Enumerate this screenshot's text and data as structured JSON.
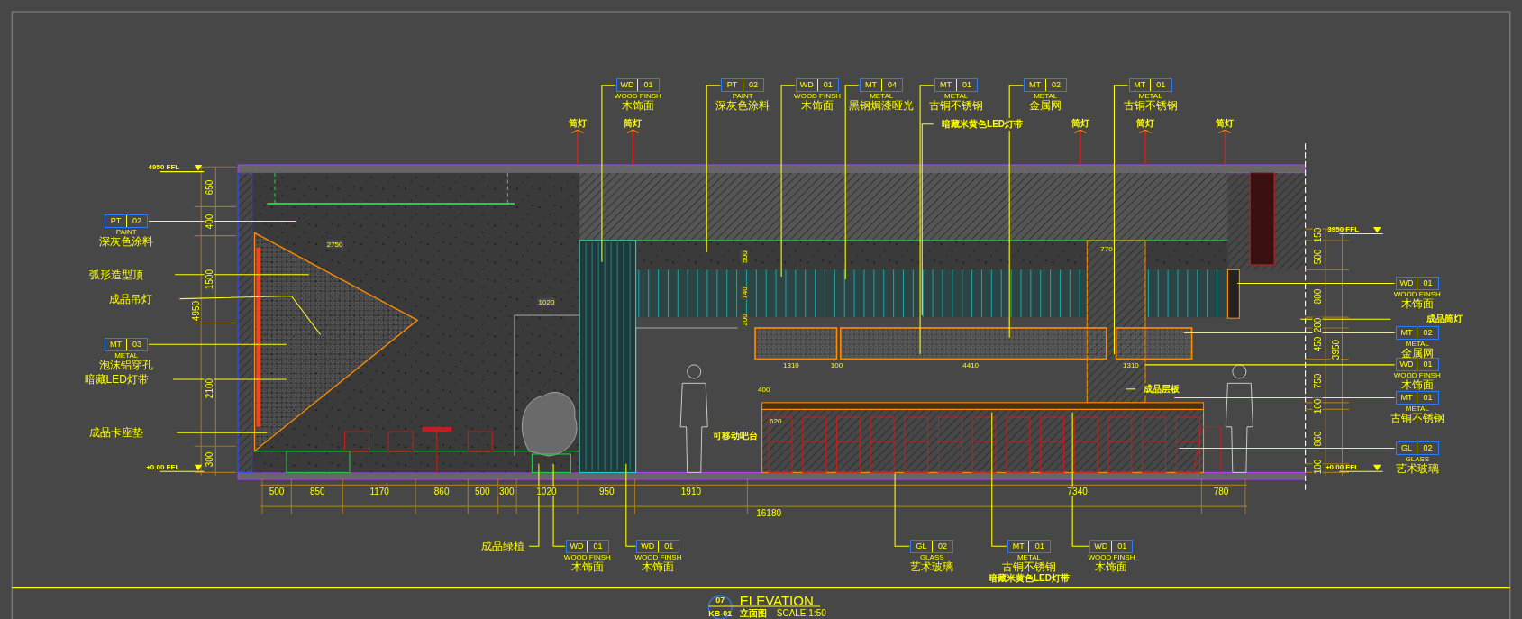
{
  "top_callouts": [
    {
      "kind": "tag",
      "code": "WD",
      "number": "01",
      "category": "WOOD FINSH",
      "name": "木饰面"
    },
    {
      "kind": "tag",
      "code": "PT",
      "number": "02",
      "category": "PAINT",
      "name": "深灰色涂料"
    },
    {
      "kind": "tag",
      "code": "WD",
      "number": "01",
      "category": "WOOD FINSH",
      "name": "木饰面"
    },
    {
      "kind": "tag",
      "code": "MT",
      "number": "04",
      "category": "METAL",
      "name": "黑钢焗漆哑光"
    },
    {
      "kind": "tag",
      "code": "MT",
      "number": "01",
      "category": "METAL",
      "name": "古铜不锈钢"
    },
    {
      "kind": "tag",
      "code": "MT",
      "number": "02",
      "category": "METAL",
      "name": "金属网"
    },
    {
      "kind": "tag",
      "code": "MT",
      "number": "01",
      "category": "METAL",
      "name": "古铜不锈钢"
    }
  ],
  "left_callouts": [
    {
      "kind": "tag",
      "code": "PT",
      "number": "02",
      "category": "PAINT",
      "name": "深灰色涂料"
    },
    {
      "kind": "text",
      "text": "弧形造型顶"
    },
    {
      "kind": "text",
      "text": "成品吊灯"
    },
    {
      "kind": "tag",
      "code": "MT",
      "number": "03",
      "category": "METAL",
      "name": "泡沫铝穿孔"
    },
    {
      "kind": "text",
      "text": "暗藏LED灯带"
    },
    {
      "kind": "text",
      "text": "成品卡座垫"
    }
  ],
  "right_callouts": [
    {
      "kind": "tag",
      "code": "WD",
      "number": "01",
      "category": "WOOD FINSH",
      "name": "木饰面"
    },
    {
      "kind": "text",
      "text": "成品筒灯"
    },
    {
      "kind": "tag",
      "code": "MT",
      "number": "02",
      "category": "METAL",
      "name": "金属网"
    },
    {
      "kind": "tag",
      "code": "WD",
      "number": "01",
      "category": "WOOD FINSH",
      "name": "木饰面"
    },
    {
      "kind": "tag",
      "code": "MT",
      "number": "01",
      "category": "METAL",
      "name": "古铜不锈钢"
    },
    {
      "kind": "tag",
      "code": "GL",
      "number": "02",
      "category": "GLASS",
      "name": "艺术玻璃"
    }
  ],
  "bottom_callouts": [
    {
      "kind": "text",
      "text": "成品绿植"
    },
    {
      "kind": "tag",
      "code": "WD",
      "number": "01",
      "category": "WOOD FINSH",
      "name": "木饰面"
    },
    {
      "kind": "tag",
      "code": "WD",
      "number": "01",
      "category": "WOOD FINSH",
      "name": "木饰面"
    },
    {
      "kind": "tag",
      "code": "GL",
      "number": "02",
      "category": "GLASS",
      "name": "艺术玻璃"
    },
    {
      "kind": "tag",
      "code": "MT",
      "number": "01",
      "category": "METAL",
      "name": "古铜不锈钢",
      "note": "暗藏米黄色LED灯带"
    },
    {
      "kind": "tag",
      "code": "WD",
      "number": "01",
      "category": "WOOD FINSH",
      "name": "木饰面"
    }
  ],
  "notes": [
    "筒灯",
    "筒灯",
    "暗藏米黄色LED灯带",
    "筒灯",
    "筒灯",
    "筒灯",
    "成品层板",
    "可移动吧台"
  ],
  "level_marks": [
    "4950 FFL",
    "±0.00 FFL",
    "3950 FFL",
    "±0.00 FFL"
  ],
  "left_dimensions": [
    "650",
    "400",
    "1500",
    "2100",
    "300"
  ],
  "left_total": "4950",
  "right_dimensions": [
    "150",
    "500",
    "800",
    "200",
    "450",
    "750",
    "100",
    "860",
    "100"
  ],
  "right_total": "3950",
  "bottom_dimensions": [
    "500",
    "850",
    "1170",
    "860",
    "500",
    "300",
    "1020",
    "950",
    "1910",
    "7340",
    "780"
  ],
  "bottom_total": "16180",
  "interior_dimensions": [
    "2750",
    "1020",
    "1310",
    "100",
    "4410",
    "1310",
    "400",
    "620",
    "770",
    "500",
    "740",
    "200"
  ],
  "title_block": {
    "number": "07",
    "sheet": "KB-01",
    "title": "ELEVATION",
    "subtitle": "立面图",
    "scale": "SCALE  1:50"
  }
}
